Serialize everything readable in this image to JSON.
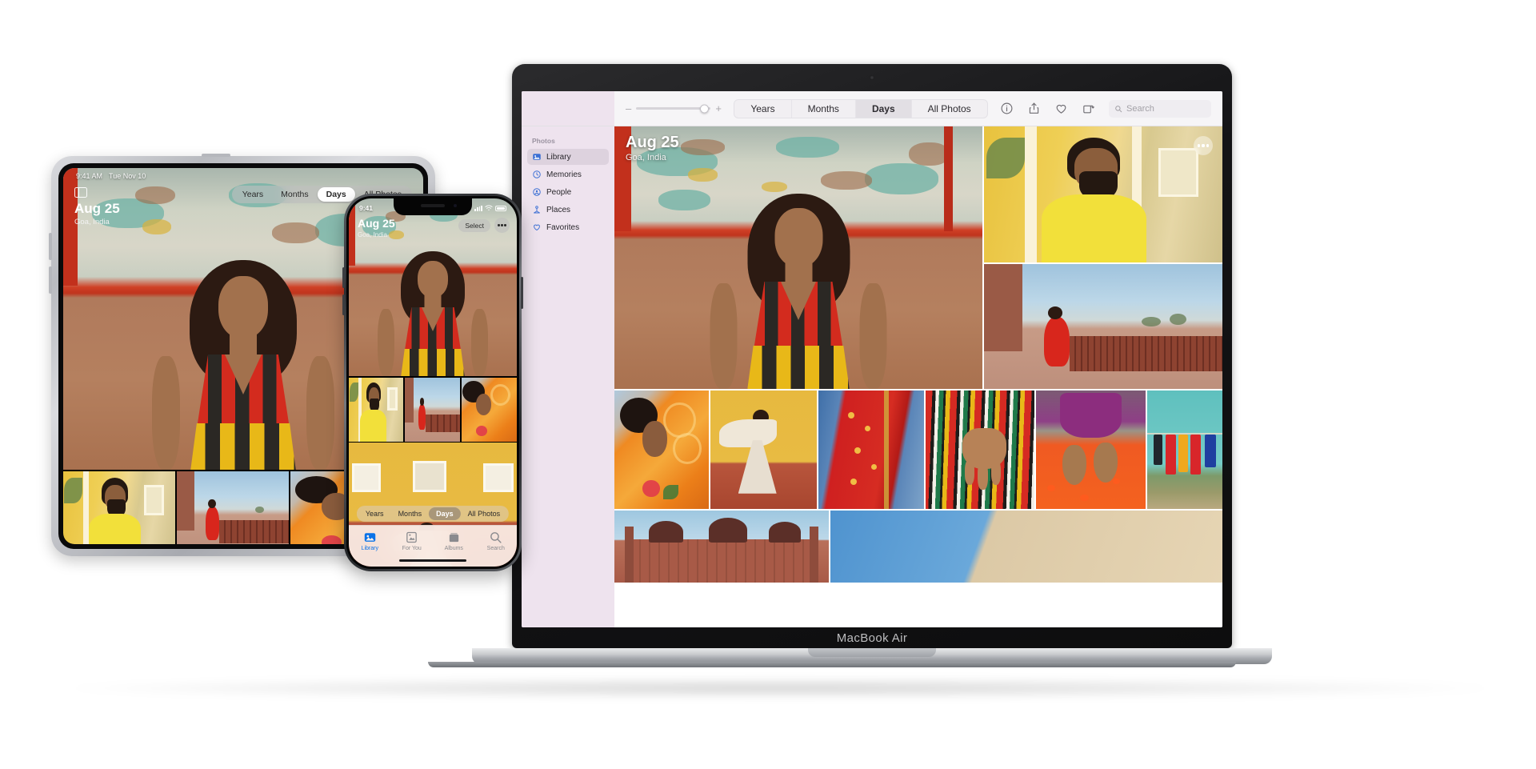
{
  "scene": {
    "description": "Apple Photos app shown on MacBook Air, iPad and iPhone",
    "background_color": "#ffffff"
  },
  "macbook": {
    "device_label": "MacBook Air",
    "toolbar": {
      "zoom_out_label": "–",
      "zoom_in_label": "+",
      "icons": [
        {
          "name": "info-icon",
          "label": "Info"
        },
        {
          "name": "share-icon",
          "label": "Share"
        },
        {
          "name": "favorite-heart-icon",
          "label": "Favorite"
        },
        {
          "name": "rotate-icon",
          "label": "Rotate"
        }
      ],
      "search": {
        "placeholder": "Search",
        "value": ""
      }
    },
    "segmented_control": {
      "options": [
        "Years",
        "Months",
        "Days",
        "All Photos"
      ],
      "selected": "Days"
    },
    "sidebar": {
      "section_title": "Photos",
      "items": [
        {
          "label": "Library",
          "icon": "library-icon",
          "selected": true
        },
        {
          "label": "Memories",
          "icon": "memories-icon",
          "selected": false
        },
        {
          "label": "People",
          "icon": "people-icon",
          "selected": false
        },
        {
          "label": "Places",
          "icon": "places-icon",
          "selected": false
        },
        {
          "label": "Favorites",
          "icon": "favorites-icon",
          "selected": false
        }
      ]
    },
    "day_header": {
      "title": "Aug 25",
      "subtitle": "Goa, India"
    },
    "more_button_label": "More options"
  },
  "ipad": {
    "status_bar": {
      "time": "9:41 AM",
      "date": "Tue Nov 10"
    },
    "sidebar_toggle_label": "Show sidebar",
    "day_header": {
      "title": "Aug 25",
      "subtitle": "Goa, India"
    },
    "segmented_control": {
      "options": [
        "Years",
        "Months",
        "Days",
        "All Photos"
      ],
      "selected": "Days"
    }
  },
  "iphone": {
    "status_bar": {
      "time": "9:41",
      "cellular": "signal-bars-icon",
      "wifi": "wifi-icon",
      "battery": "battery-icon"
    },
    "day_header": {
      "title": "Aug 25",
      "subtitle": "Goa, India"
    },
    "select_button_label": "Select",
    "more_button_label": "More options",
    "segmented_control": {
      "options": [
        "Years",
        "Months",
        "Days",
        "All Photos"
      ],
      "selected": "Days"
    },
    "tab_bar": {
      "tabs": [
        {
          "label": "Library",
          "icon": "library-icon",
          "selected": true
        },
        {
          "label": "For You",
          "icon": "for-you-icon",
          "selected": false
        },
        {
          "label": "Albums",
          "icon": "albums-icon",
          "selected": false
        },
        {
          "label": "Search",
          "icon": "search-icon",
          "selected": false
        }
      ]
    }
  },
  "photos": [
    {
      "id": "hero",
      "alt": "Woman in red and yellow striped dress against peeling teal wall"
    },
    {
      "id": "man",
      "alt": "Man in yellow kurta in yellow corridor"
    },
    {
      "id": "sari",
      "alt": "Woman in red sari walking by monument"
    },
    {
      "id": "orange",
      "alt": "Woman wearing orange floral sari"
    },
    {
      "id": "twirl",
      "alt": "Woman in white sari twirling on yellow wall"
    },
    {
      "id": "bandhani",
      "alt": "Red bandhani sari against blue wall"
    },
    {
      "id": "hand",
      "alt": "Hand holding multicolor striped fabric"
    },
    {
      "id": "feet",
      "alt": "Bare feet standing on orange powder"
    },
    {
      "id": "laundry",
      "alt": "Colorful laundry drying on teal wall"
    },
    {
      "id": "mosque",
      "alt": "Mosque domes against blue sky"
    },
    {
      "id": "sky",
      "alt": "Blue sky and beige wall"
    }
  ],
  "colors": {
    "accent_blue": "#0a72e8",
    "sidebar_bg": "#eee3ee",
    "toolbar_bg": "#f6f5f7",
    "selected_seg": "#e2dfe4"
  }
}
